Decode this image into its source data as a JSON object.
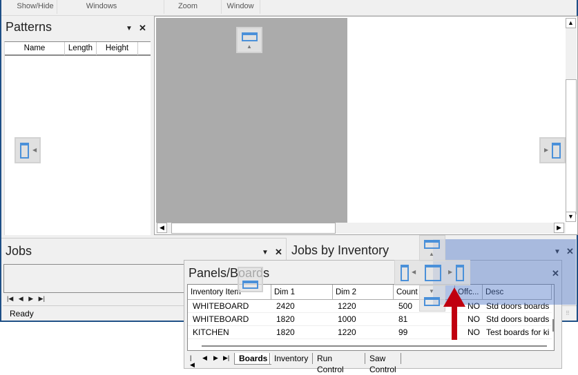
{
  "ribbon": {
    "groups": [
      {
        "label": "Show/Hide"
      },
      {
        "label": "Windows"
      },
      {
        "label": "Zoom"
      },
      {
        "label": "Window"
      }
    ]
  },
  "patterns_panel": {
    "title": "Patterns",
    "columns": [
      "Name",
      "Length",
      "Height"
    ]
  },
  "jobs_panel": {
    "title": "Jobs"
  },
  "jobs_by_inventory_panel": {
    "title": "Jobs by Inventory"
  },
  "panels_boards": {
    "title": "Panels/Boards",
    "columns": [
      "Inventory Item",
      "Dim 1",
      "Dim 2",
      "Count",
      "Offc...",
      "Desc"
    ],
    "rows": [
      {
        "item": "WHITEBOARD",
        "dim1": "2420",
        "dim2": "1220",
        "count": "500",
        "offcut": "NO",
        "desc": "Std doors boards"
      },
      {
        "item": "WHITEBOARD",
        "dim1": "1820",
        "dim2": "1000",
        "count": "81",
        "offcut": "NO",
        "desc": "Std doors boards"
      },
      {
        "item": "KITCHEN",
        "dim1": "1820",
        "dim2": "1220",
        "count": "99",
        "offcut": "NO",
        "desc": "Test boards for ki"
      }
    ],
    "tabs": [
      {
        "label": "Boards",
        "active": true
      },
      {
        "label": "Inventory",
        "active": false
      },
      {
        "label": "Run Control",
        "active": false
      },
      {
        "label": "Saw Control",
        "active": false
      }
    ]
  },
  "statusbar": {
    "text": "Ready"
  },
  "icons": {
    "pin": "▼",
    "close": "✕",
    "nav_first": "⏮",
    "scroll_up": "▲",
    "scroll_down": "▼",
    "scroll_left": "◀",
    "scroll_right": "▶"
  },
  "colors": {
    "dock_preview": "#7a9bd6",
    "dock_icon": "#4a90d9",
    "arrow": "#c00010"
  }
}
